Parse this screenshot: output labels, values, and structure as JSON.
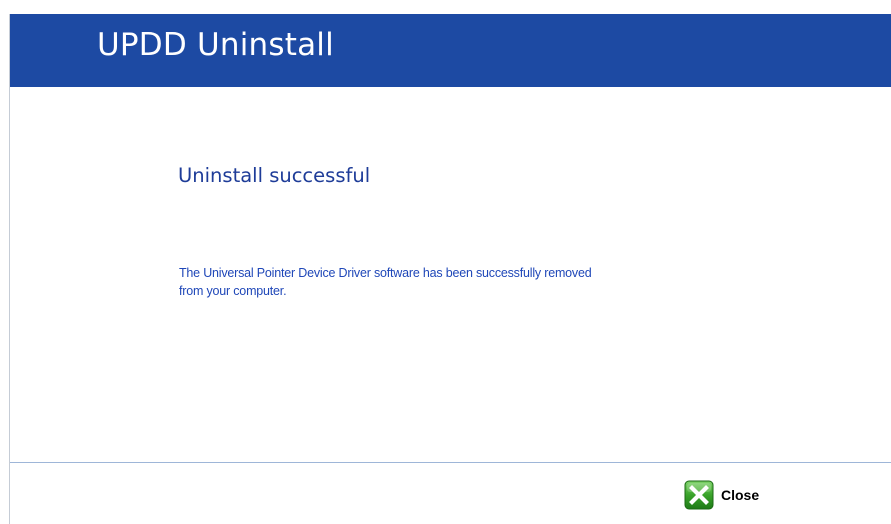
{
  "header": {
    "title": "UPDD Uninstall"
  },
  "main": {
    "heading": "Uninstall successful",
    "message": "The Universal Pointer Device Driver software has been successfully removed from your computer."
  },
  "footer": {
    "close_label": "Close",
    "close_icon": "close-icon"
  },
  "colors": {
    "header_bg": "#1d4aa3",
    "heading_text": "#1e3c98",
    "message_text": "#1f47b8",
    "close_icon_green": "#3aa32a"
  }
}
